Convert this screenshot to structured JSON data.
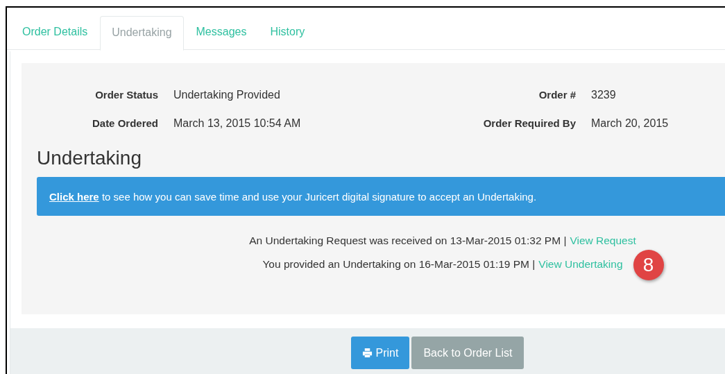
{
  "tabs": [
    {
      "label": "Order Details",
      "selected": false
    },
    {
      "label": "Undertaking",
      "selected": true
    },
    {
      "label": "Messages",
      "selected": false
    },
    {
      "label": "History",
      "selected": false
    }
  ],
  "order_info": {
    "left": [
      {
        "label": "Order Status",
        "value": "Undertaking Provided"
      },
      {
        "label": "Date Ordered",
        "value": "March 13, 2015 10:54 AM"
      }
    ],
    "right": [
      {
        "label": "Order #",
        "value": "3239"
      },
      {
        "label": "Order Required By",
        "value": "March 20, 2015"
      }
    ]
  },
  "heading": "Undertaking",
  "banner": {
    "link": "Click here",
    "text": "to see how you can save time and use your Juricert digital signature to accept an Undertaking."
  },
  "events": [
    {
      "text": "An Undertaking Request was received on 13-Mar-2015 01:32 PM |",
      "link": "View Request"
    },
    {
      "text": "You provided an Undertaking on 16-Mar-2015 01:19 PM |",
      "link": "View Undertaking",
      "badge": "8"
    }
  ],
  "buttons": [
    {
      "label": "Print",
      "kind": "primary"
    },
    {
      "label": "Back to Order List",
      "kind": "secondary"
    }
  ]
}
